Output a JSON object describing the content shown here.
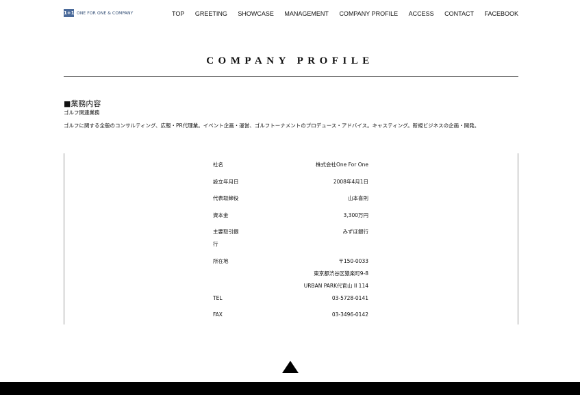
{
  "header": {
    "logo_mark": "1+1",
    "logo_text": "ONE FOR ONE & COMPANY",
    "nav": [
      "TOP",
      "GREETING",
      "SHOWCASE",
      "MANAGEMENT",
      "COMPANY PROFILE",
      "ACCESS",
      "CONTACT",
      "FACEBOOK"
    ]
  },
  "page_title": "COMPANY PROFILE",
  "business": {
    "heading": "■業務内容",
    "subheading": "ゴルフ関連業務",
    "description": "ゴルフに関する全般のコンサルティング、広報・PR代理業。イベント企画・運営、ゴルフトーナメントのプロデュース・アドバイス。キャスティング。新規ビジネスの企画・開発。"
  },
  "profile": [
    {
      "label": "社名",
      "values": [
        "株式会社One For One"
      ]
    },
    {
      "label": "設立年月日",
      "values": [
        "2008年4月1日"
      ]
    },
    {
      "label": "代表取締役",
      "values": [
        "山本喜則"
      ]
    },
    {
      "label": "資本金",
      "values": [
        "3,300万円"
      ]
    },
    {
      "label": "主要取引銀行",
      "values": [
        "みずほ銀行"
      ]
    },
    {
      "label": "所在地",
      "values": [
        "〒150-0033",
        "東京都渋谷区猿楽町9-8",
        "URBAN PARK代官山 II 114"
      ]
    },
    {
      "label": "TEL",
      "values": [
        "03-5728-0141"
      ]
    },
    {
      "label": "FAX",
      "values": [
        "03-3496-0142"
      ]
    }
  ]
}
